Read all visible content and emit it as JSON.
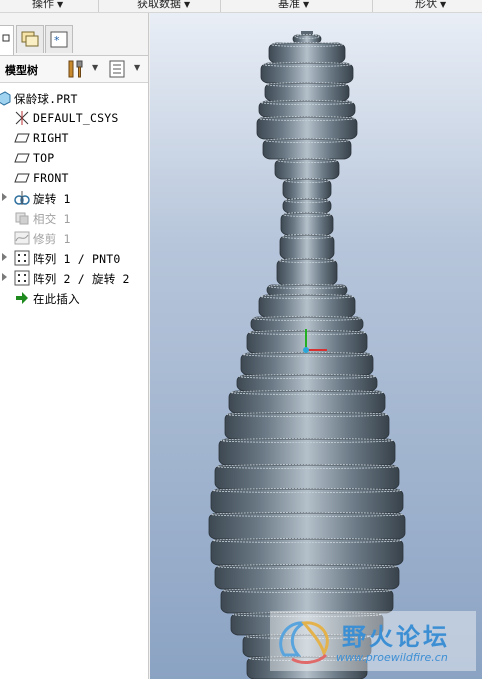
{
  "menubar": {
    "items": [
      {
        "label": "操作"
      },
      {
        "label": "获取数据"
      },
      {
        "label": "基准"
      },
      {
        "label": "形状"
      }
    ]
  },
  "tabs": [
    {
      "icon": "model-tree-tab-icon"
    },
    {
      "icon": "folder-browser-tab-icon"
    },
    {
      "icon": "favorites-tab-icon"
    }
  ],
  "model_tree": {
    "title": "模型树",
    "settings_icon": "tree-settings-icon",
    "columns_icon": "tree-columns-icon",
    "items": [
      {
        "label": "保龄球.PRT",
        "icon": "part-icon",
        "expandable": false,
        "disabled": false
      },
      {
        "label": "DEFAULT_CSYS",
        "icon": "csys-icon",
        "expandable": false,
        "disabled": false
      },
      {
        "label": "RIGHT",
        "icon": "datum-plane-icon",
        "expandable": false,
        "disabled": false
      },
      {
        "label": "TOP",
        "icon": "datum-plane-icon",
        "expandable": false,
        "disabled": false
      },
      {
        "label": "FRONT",
        "icon": "datum-plane-icon",
        "expandable": false,
        "disabled": false
      },
      {
        "label": "旋转 1",
        "icon": "revolve-icon",
        "expandable": true,
        "disabled": false
      },
      {
        "label": "相交 1",
        "icon": "intersect-icon",
        "expandable": false,
        "disabled": true
      },
      {
        "label": "修剪 1",
        "icon": "trim-icon",
        "expandable": false,
        "disabled": true
      },
      {
        "label": "阵列 1 / PNT0",
        "icon": "pattern-icon",
        "expandable": true,
        "disabled": false
      },
      {
        "label": "阵列 2 / 旋转 2",
        "icon": "pattern-icon",
        "expandable": true,
        "disabled": false
      },
      {
        "label": "在此插入",
        "icon": "insert-here-arrow-icon",
        "expandable": false,
        "disabled": false
      }
    ]
  },
  "viewport": {
    "model": "bowling-pin-3d-model",
    "colors": {
      "bg_top": "#e9eef6",
      "bg_bottom": "#8ba3c3",
      "model": "#6b7a86"
    }
  },
  "watermark": {
    "brand": "野火论坛",
    "url": "www.proewildfire.cn"
  }
}
